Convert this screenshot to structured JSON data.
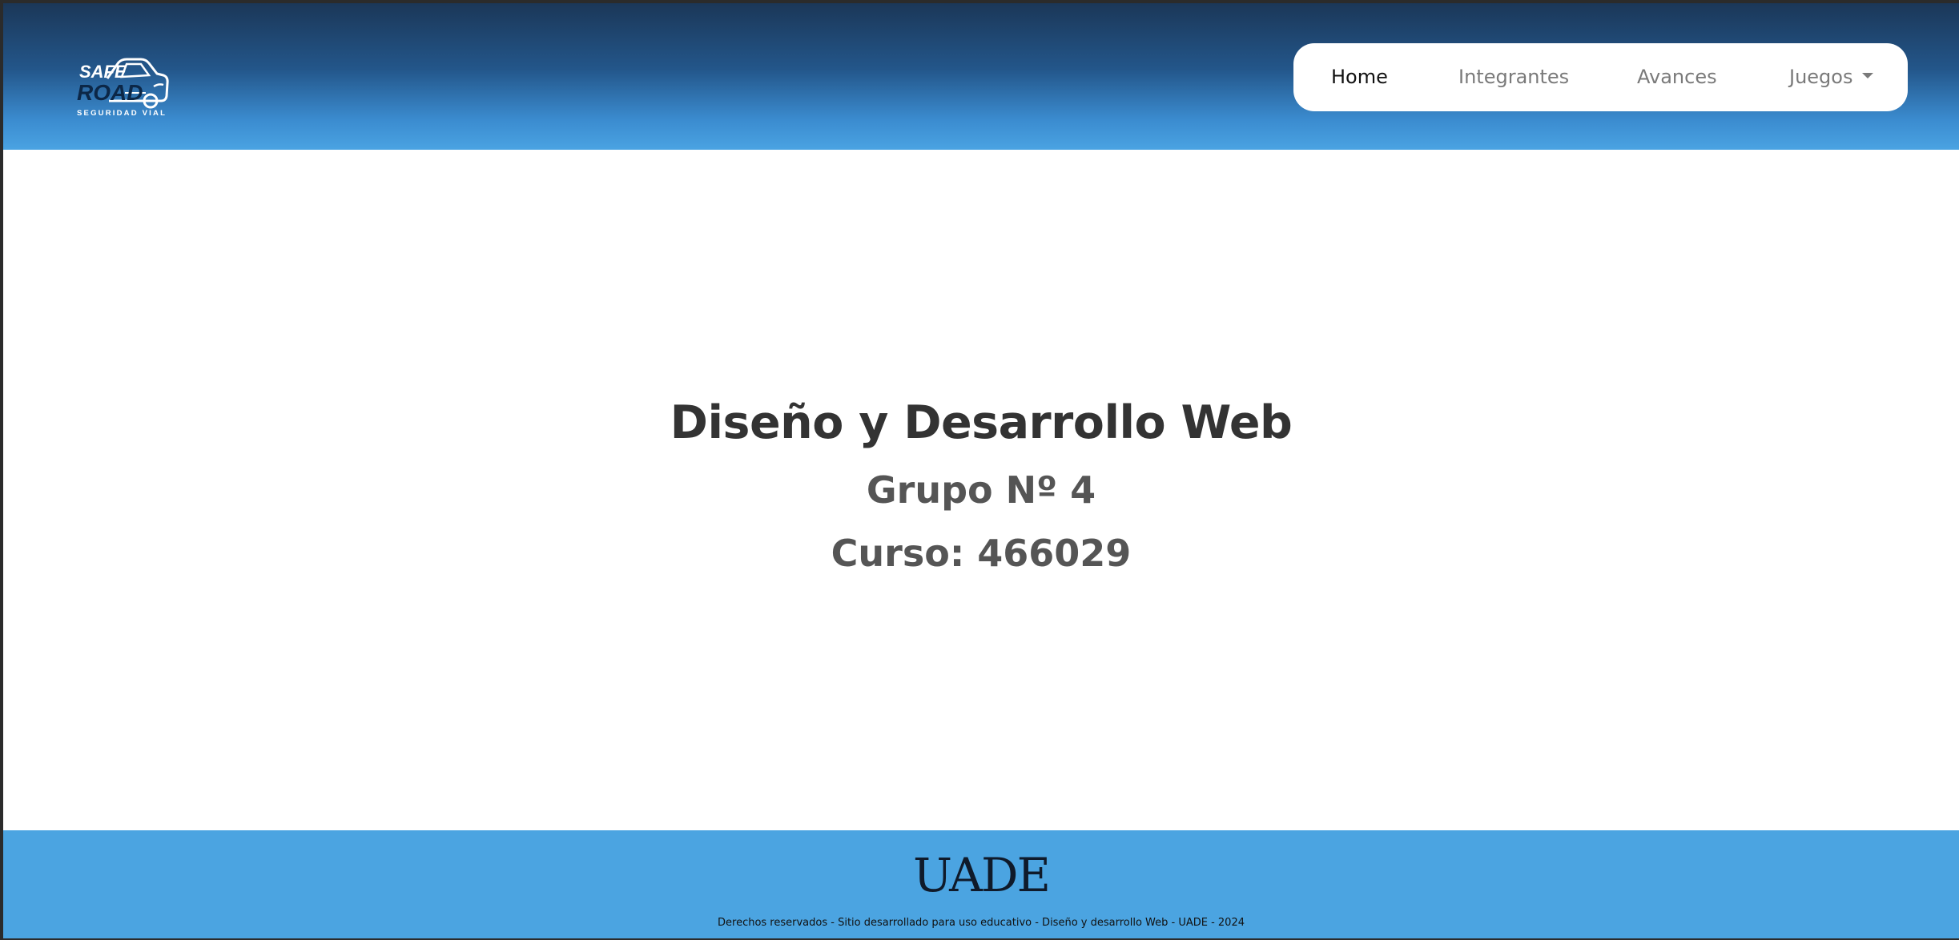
{
  "header": {
    "logo": {
      "line1": "SAFE",
      "line2": "ROAD",
      "tagline": "SEGURIDAD VIAL",
      "icon": "car-icon"
    },
    "nav": {
      "items": [
        {
          "label": "Home",
          "active": true
        },
        {
          "label": "Integrantes",
          "active": false
        },
        {
          "label": "Avances",
          "active": false
        },
        {
          "label": "Juegos",
          "active": false,
          "has_dropdown": true
        }
      ]
    }
  },
  "main": {
    "title": "Diseño y Desarrollo Web",
    "group": "Grupo Nº 4",
    "course": "Curso: 466029"
  },
  "footer": {
    "brand": "UADE",
    "copyright": "Derechos reservados - Sitio desarrollado para uso educativo - Diseño y desarrollo Web - UADE - 2024"
  },
  "colors": {
    "header_top": "#1b3758",
    "header_bottom": "#4aa3e2",
    "footer_bg": "#4ba4e1",
    "title_text": "#333333",
    "subtitle_text": "#555555"
  }
}
